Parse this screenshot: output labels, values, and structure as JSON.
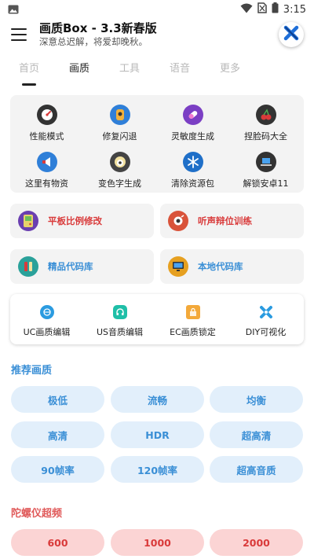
{
  "status_bar": {
    "time": "3:15"
  },
  "header": {
    "title": "画质Box - 3.3新春版",
    "subtitle": "深意总迟解，将爱却晚秋。"
  },
  "tabs": [
    {
      "label": "首页",
      "active": false
    },
    {
      "label": "画质",
      "active": true
    },
    {
      "label": "工具",
      "active": false
    },
    {
      "label": "语音",
      "active": false
    },
    {
      "label": "更多",
      "active": false
    }
  ],
  "grid_items": [
    {
      "label": "性能模式",
      "icon": "speedometer-icon",
      "color": "#333333"
    },
    {
      "label": "修复闪退",
      "icon": "bug-fix-icon",
      "color": "#2f7fd8"
    },
    {
      "label": "灵敏度生成",
      "icon": "pill-icon",
      "color": "#7b3fc4"
    },
    {
      "label": "捏脸码大全",
      "icon": "cherry-icon",
      "color": "#333333"
    },
    {
      "label": "这里有物资",
      "icon": "megaphone-icon",
      "color": "#2f7fd8"
    },
    {
      "label": "变色字生成",
      "icon": "face-icon",
      "color": "#444444"
    },
    {
      "label": "清除资源包",
      "icon": "snowflake-icon",
      "color": "#1f6fc8"
    },
    {
      "label": "解锁安卓11",
      "icon": "laptop-icon",
      "color": "#333333"
    }
  ],
  "features": [
    {
      "label": "平板比例修改",
      "icon": "gameboy-icon",
      "color": "#d93a3a",
      "icon_bg": "#6a3fb0"
    },
    {
      "label": "听声辩位训练",
      "icon": "ear-icon",
      "color": "#d93a3a",
      "icon_bg": "#d9533a"
    },
    {
      "label": "精品代码库",
      "icon": "code-library-icon",
      "color": "#3a8fd6",
      "icon_bg": "#2aa19a"
    },
    {
      "label": "本地代码库",
      "icon": "monitor-icon",
      "color": "#3a8fd6",
      "icon_bg": "#e6a020"
    }
  ],
  "editors": [
    {
      "label": "UC画质编辑",
      "icon": "globe-icon",
      "color": "#2b9be0"
    },
    {
      "label": "US音质编辑",
      "icon": "headphones-icon",
      "color": "#1fbfa8"
    },
    {
      "label": "EC画质锁定",
      "icon": "lock-icon",
      "color": "#f3a93a"
    },
    {
      "label": "DIY可视化",
      "icon": "puzzle-icon",
      "color": "#2b9be0"
    }
  ],
  "recommended": {
    "title": "推荐画质",
    "title_color": "#3a8fd6",
    "options": [
      "极低",
      "流畅",
      "均衡",
      "高清",
      "HDR",
      "超高清",
      "90帧率",
      "120帧率",
      "超高音质"
    ]
  },
  "gyro": {
    "title": "陀螺仪超频",
    "title_color": "#e05a5a",
    "options": [
      "600",
      "1000",
      "2000"
    ]
  }
}
